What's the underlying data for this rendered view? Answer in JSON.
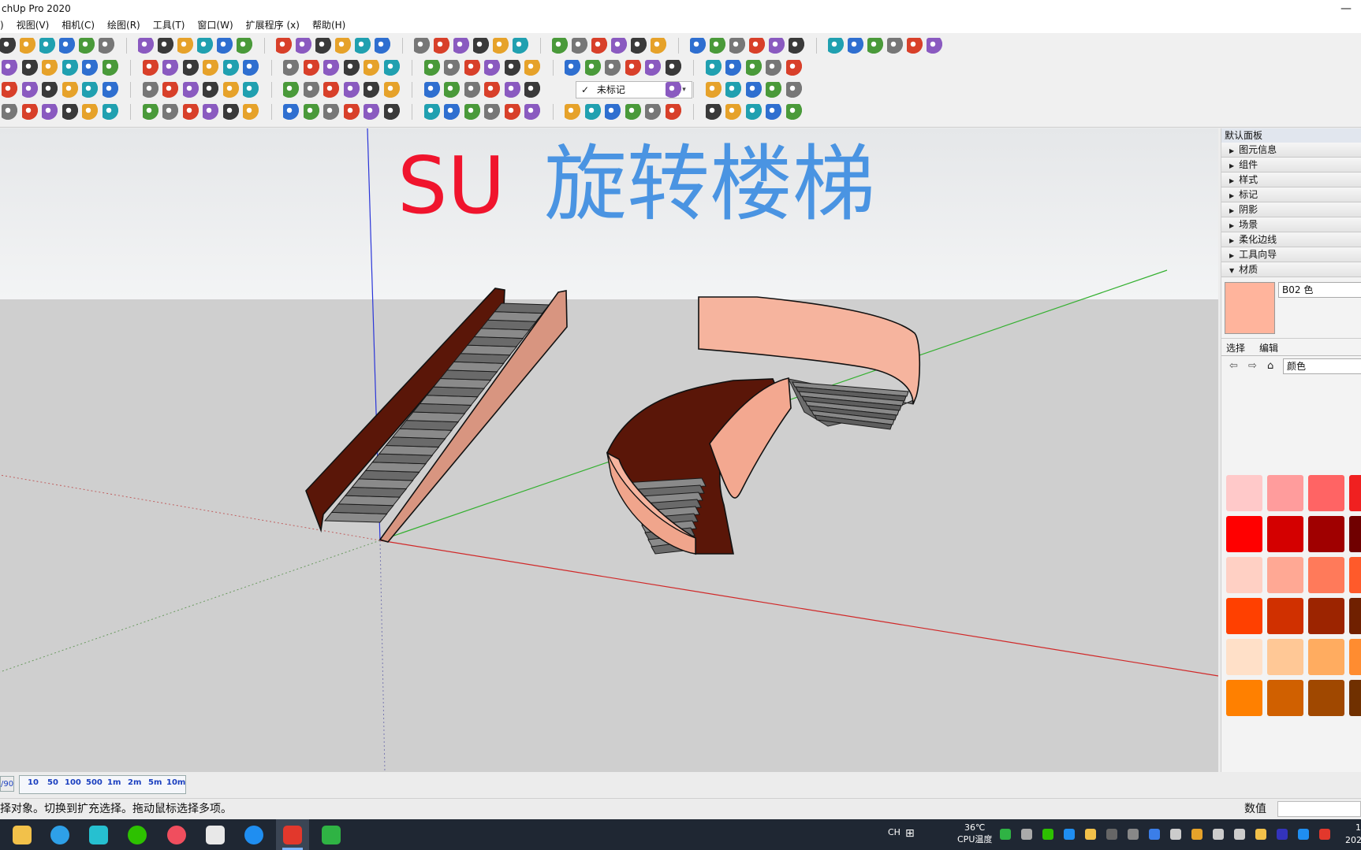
{
  "window": {
    "title": "chUp Pro 2020",
    "minimize": "—"
  },
  "menubar": {
    "items": [
      ")",
      "视图(V)",
      "相机(C)",
      "绘图(R)",
      "工具(T)",
      "窗口(W)",
      "扩展程序 (x)",
      "帮助(H)"
    ]
  },
  "toolbar": {
    "tag_check": "✓",
    "tag_selected": "未标记",
    "tag_chevron": "▾"
  },
  "viewport": {
    "overlay_su": "SU",
    "overlay_title": "旋转楼梯",
    "colors": {
      "su": "#f0142d",
      "title": "#4a94e2",
      "sky": "#eef0f1",
      "ground": "#cfcfcf",
      "wall_light": "#d89580",
      "wall_dark": "#5a1608",
      "spiral_light": "#f6b49e",
      "steps": "#6c6c6c"
    }
  },
  "tray": {
    "title": "默认面板",
    "sections": [
      "图元信息",
      "组件",
      "样式",
      "标记",
      "阴影",
      "场景",
      "柔化边线",
      "工具向导"
    ],
    "materials": {
      "header": "材质",
      "current_name": "B02 色",
      "current_color": "#ffb49c",
      "tab_select": "选择",
      "tab_edit": "编辑",
      "library": "颜色",
      "swatches": [
        "#ffc9c9",
        "#ff9c9c",
        "#ff6464",
        "#f02020",
        "#ff0000",
        "#d40000",
        "#a00000",
        "#700000",
        "#ffd0c4",
        "#ffa894",
        "#ff7a5a",
        "#ff5a2a",
        "#ff4000",
        "#d03000",
        "#9c2400",
        "#702000",
        "#ffe0c8",
        "#ffc896",
        "#ffac60",
        "#ff8c30",
        "#ff8000",
        "#d06000",
        "#a04800",
        "#703000"
      ]
    }
  },
  "scale": {
    "fraction": "/90",
    "labels": [
      "10",
      "50",
      "100",
      "500",
      "1m",
      "2m",
      "5m",
      "10m"
    ]
  },
  "status": {
    "text": "择对象。切换到扩充选择。拖动鼠标选择多项。",
    "value_label": "数值"
  },
  "taskbar": {
    "ime": "CH",
    "grid": "⊞",
    "temp": "36℃",
    "temp_label": "CPU温度",
    "clock_top": "1",
    "clock_bottom": "202"
  }
}
